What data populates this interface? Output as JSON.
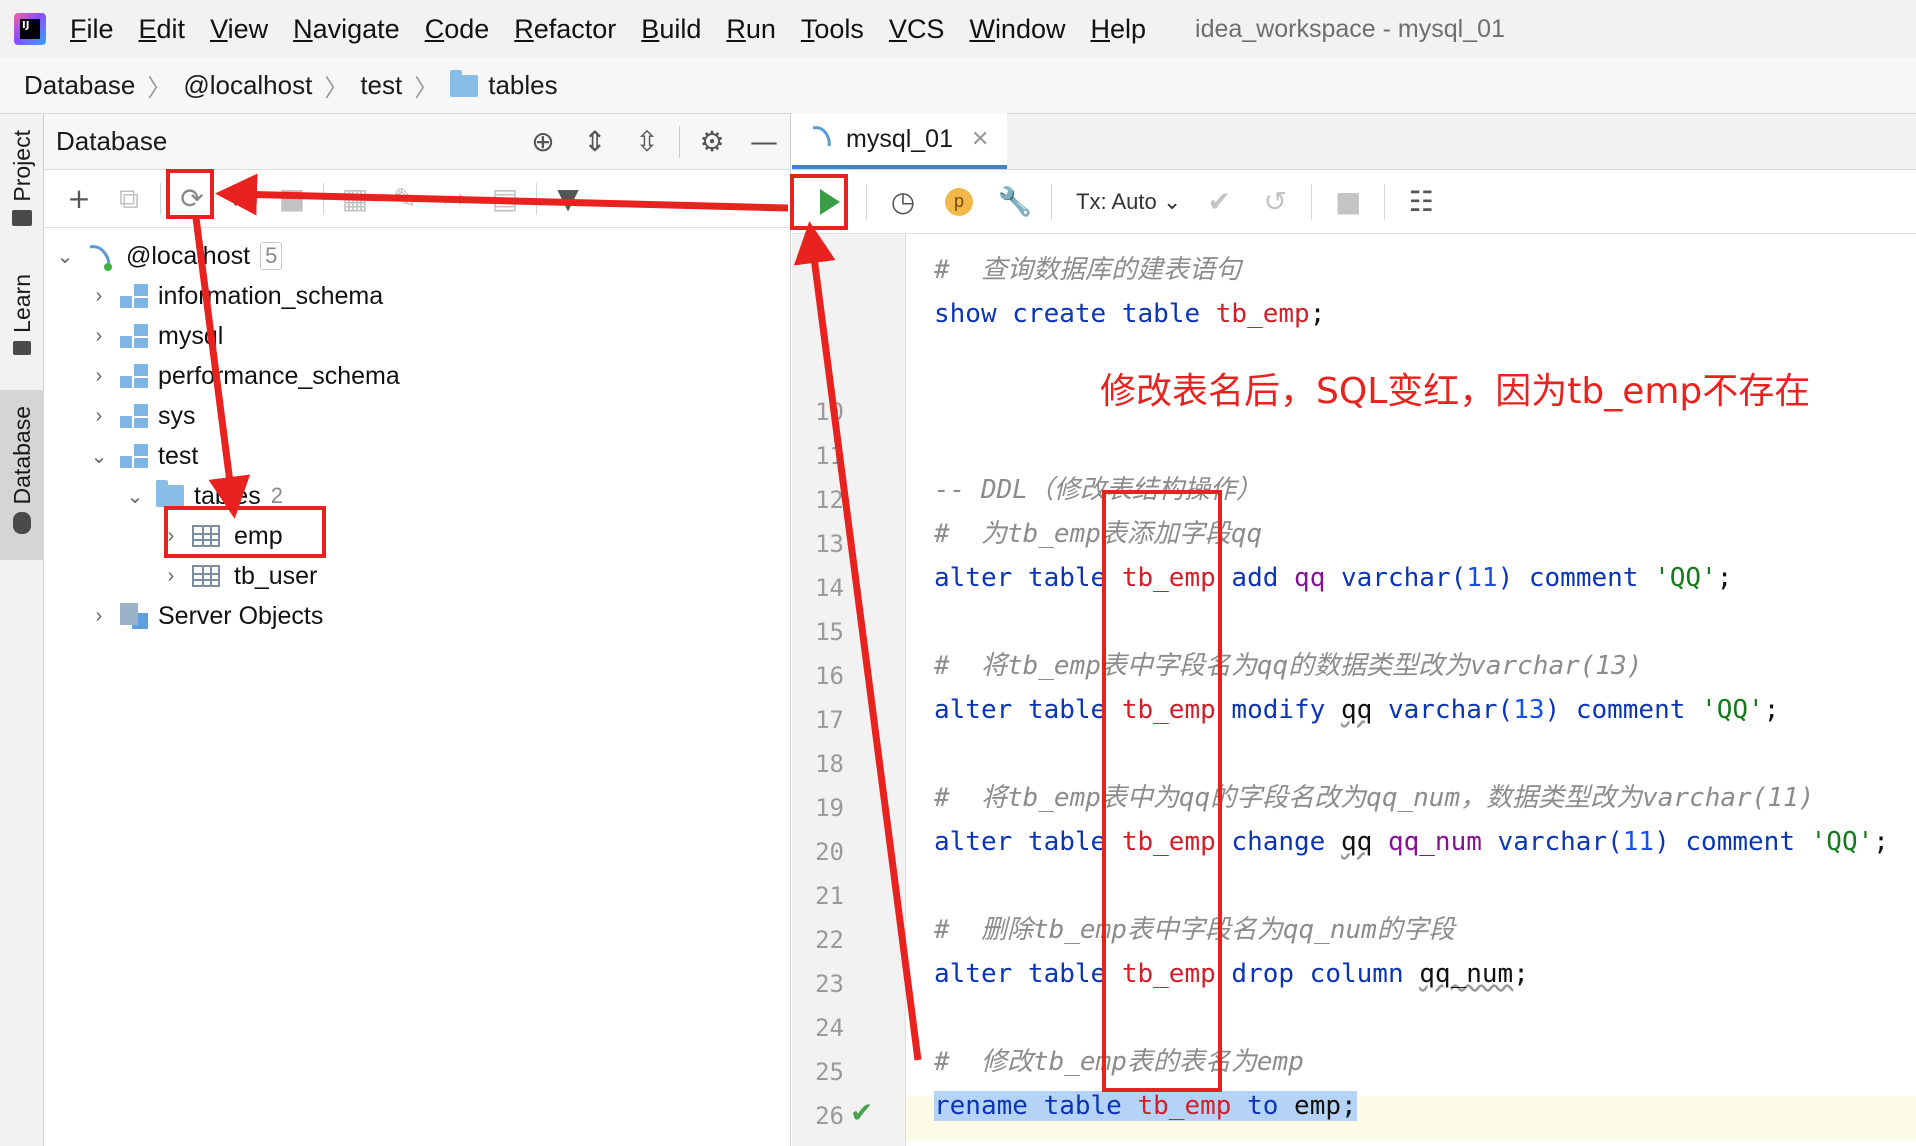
{
  "app": {
    "window_title": "idea_workspace - mysql_01"
  },
  "menu": [
    "File",
    "Edit",
    "View",
    "Navigate",
    "Code",
    "Refactor",
    "Build",
    "Run",
    "Tools",
    "VCS",
    "Window",
    "Help"
  ],
  "breadcrumbs": [
    "Database",
    "@localhost",
    "test",
    "tables"
  ],
  "left_strip": {
    "tabs": [
      "Project",
      "Learn",
      "Database"
    ]
  },
  "db_panel": {
    "title": "Database",
    "tree": {
      "connection": {
        "label": "@localhost",
        "count": "5"
      },
      "schemas": [
        "information_schema",
        "mysql",
        "performance_schema",
        "sys",
        "test"
      ],
      "tables_folder": {
        "label": "tables",
        "count": "2"
      },
      "tables": [
        "emp",
        "tb_user"
      ],
      "server_objects": "Server Objects"
    }
  },
  "editor": {
    "tab_label": "mysql_01",
    "tx_label": "Tx: Auto",
    "p_badge": "p",
    "line_numbers": [
      "10",
      "11",
      "12",
      "13",
      "14",
      "15",
      "16",
      "17",
      "18",
      "19",
      "20",
      "21",
      "22",
      "23",
      "24",
      "25",
      "26"
    ],
    "code": {
      "l1_comment": "#  查询数据库的建表语句",
      "l2": {
        "kw1": "show create table ",
        "tbl": "tb_emp",
        "end": ";"
      },
      "l5_comment": "-- DDL（修改表结构操作）",
      "l6_comment": "#  为tb_emp表添加字段qq",
      "l7": {
        "kw1": "alter table ",
        "tbl": "tb_emp",
        "kw2": " add ",
        "field": "qq",
        "kw3": " varchar(",
        "num": "11",
        "kw4": ") comment ",
        "str": "'QQ'",
        "end": ";"
      },
      "l9_comment": "#  将tb_emp表中字段名为qq的数据类型改为varchar(13)",
      "l10": {
        "kw1": "alter table ",
        "tbl": "tb_emp",
        "kw2": " modify ",
        "field": "qq",
        "kw3": " varchar(",
        "num": "13",
        "kw4": ") comment ",
        "str": "'QQ'",
        "end": ";"
      },
      "l12_comment": "#  将tb_emp表中为qq的字段名改为qq_num，数据类型改为varchar(11)",
      "l13": {
        "kw1": "alter table ",
        "tbl": "tb_emp",
        "kw2": " change ",
        "field1": "qq",
        "sp": " ",
        "field2": "qq_num",
        "kw3": " varchar(",
        "num": "11",
        "kw4": ") comment ",
        "str": "'QQ'",
        "end": ";"
      },
      "l15_comment": "#  删除tb_emp表中字段名为qq_num的字段",
      "l16": {
        "kw1": "alter table ",
        "tbl": "tb_emp",
        "kw2": " drop column ",
        "field": "qq_num",
        "end": ";"
      },
      "l18_comment": "#  修改tb_emp表的表名为emp",
      "l19": {
        "kw1": "rename table ",
        "tbl": "tb_emp",
        "kw2": " to ",
        "pl": "emp",
        "end": ";"
      }
    }
  },
  "annotation": {
    "text": "修改表名后，SQL变红，因为tb_emp不存在",
    "color": "#e8231f"
  }
}
